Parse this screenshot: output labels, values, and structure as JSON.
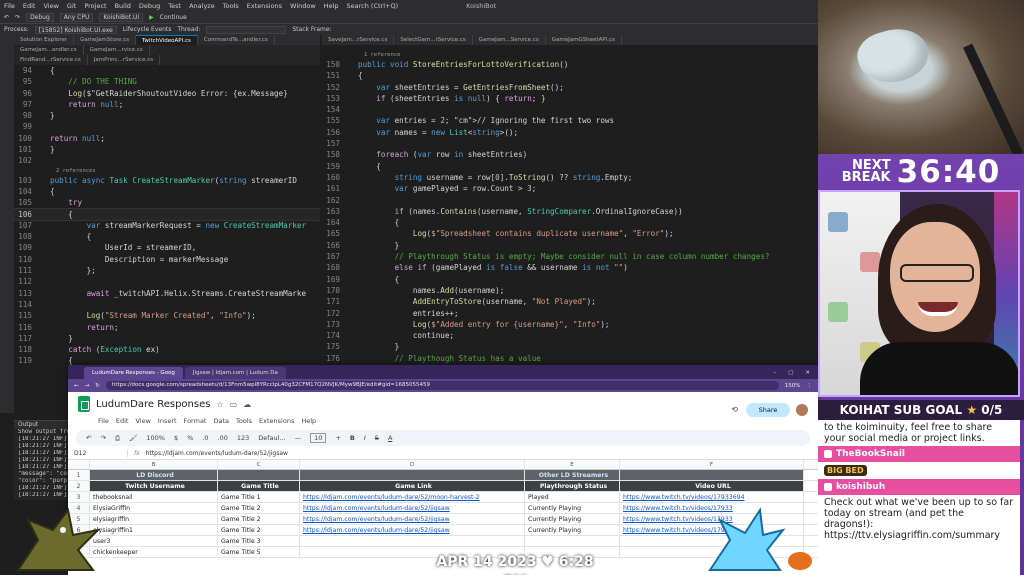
{
  "ide": {
    "menu": [
      "File",
      "Edit",
      "View",
      "Git",
      "Project",
      "Build",
      "Debug",
      "Test",
      "Analyze",
      "Tools",
      "Extensions",
      "Window",
      "Help",
      "Search (Ctrl+Q)"
    ],
    "solution_name": "KoishiBot",
    "toolbar": {
      "config": "Debug",
      "platform": "Any CPU",
      "project": "KoishiBot.UI",
      "continue": "Continue"
    },
    "procbar": {
      "process_label": "Process:",
      "process": "[15852] KoishiBot.UI.exe",
      "lifecycle": "Lifecycle Events",
      "thread_label": "Thread:",
      "stackframe": "Stack Frame:"
    },
    "left_tabs": [
      "Solution Explorer",
      "GameJamStore.cs",
      "TwitchVideoAPI.cs",
      "CommandTe...andler.cs"
    ],
    "left_tabs2": [
      "GameJam...andler.cs",
      "GameJam...rvice.cs"
    ],
    "left_tabs3": [
      "FindRand...rService.cs",
      "JamPrinc...rService.cs"
    ],
    "right_tabs": [
      "SaveJam...rService.cs",
      "SelectGam...rService.cs",
      "GameJam...Service.cs",
      "GameJamGSheetAPI.cs"
    ],
    "left_code": [
      {
        "n": "94",
        "t": "{"
      },
      {
        "n": "95",
        "t": "    // DO THE THING"
      },
      {
        "n": "96",
        "t": "    Log($\"GetRaiderShoutoutVideo Error: {ex.Message}"
      },
      {
        "n": "97",
        "t": "    return null;"
      },
      {
        "n": "98",
        "t": "}"
      },
      {
        "n": "99",
        "t": ""
      },
      {
        "n": "100",
        "t": "return null;"
      },
      {
        "n": "101",
        "t": "}"
      },
      {
        "n": "102",
        "t": ""
      },
      {
        "meta": "2 references"
      },
      {
        "n": "103",
        "t": "public async Task CreateStreamMarker(string streamerID"
      },
      {
        "n": "104",
        "t": "{"
      },
      {
        "n": "105",
        "t": "    try"
      },
      {
        "n": "106",
        "t": "    {"
      },
      {
        "n": "107",
        "t": "        var streamMarkerRequest = new CreateStreamMarker"
      },
      {
        "n": "108",
        "t": "        {"
      },
      {
        "n": "109",
        "t": "            UserId = streamerID,"
      },
      {
        "n": "110",
        "t": "            Description = markerMessage"
      },
      {
        "n": "111",
        "t": "        };"
      },
      {
        "n": "112",
        "t": ""
      },
      {
        "n": "113",
        "t": "        await _twitchAPI.Helix.Streams.CreateStreamMarke"
      },
      {
        "n": "114",
        "t": ""
      },
      {
        "n": "115",
        "t": "        Log(\"Stream Marker Created\", \"Info\");"
      },
      {
        "n": "116",
        "t": "        return;"
      },
      {
        "n": "117",
        "t": "    }"
      },
      {
        "n": "118",
        "t": "    catch (Exception ex)"
      },
      {
        "n": "119",
        "t": "    {"
      }
    ],
    "right_code": [
      {
        "meta": "1 reference"
      },
      {
        "n": "150",
        "t": "public void StoreEntriesForLottoVerification()"
      },
      {
        "n": "151",
        "t": "{"
      },
      {
        "n": "152",
        "t": "    var sheetEntries = GetEntriesFromSheet();"
      },
      {
        "n": "153",
        "t": "    if (sheetEntries is null) { return; }"
      },
      {
        "n": "154",
        "t": ""
      },
      {
        "n": "155",
        "t": "    var entries = 2; // Ignoring the first two rows"
      },
      {
        "n": "156",
        "t": "    var names = new List<string>();"
      },
      {
        "n": "157",
        "t": ""
      },
      {
        "n": "158",
        "t": "    foreach (var row in sheetEntries)"
      },
      {
        "n": "159",
        "t": "    {"
      },
      {
        "n": "160",
        "t": "        string username = row[0].ToString() ?? string.Empty;"
      },
      {
        "n": "161",
        "t": "        var gamePlayed = row.Count > 3;"
      },
      {
        "n": "162",
        "t": ""
      },
      {
        "n": "163",
        "t": "        if (names.Contains(username, StringComparer.OrdinalIgnoreCase))"
      },
      {
        "n": "164",
        "t": "        {"
      },
      {
        "n": "165",
        "t": "            Log($\"Spreadsheet contains duplicate username\", \"Error\");"
      },
      {
        "n": "166",
        "t": "        }"
      },
      {
        "n": "167",
        "t": "        // Playthrough Status is empty; Maybe consider null in case column number changes?"
      },
      {
        "n": "168",
        "t": "        else if (gamePlayed is false && username is not \"\")"
      },
      {
        "n": "169",
        "t": "        {"
      },
      {
        "n": "170",
        "t": "            names.Add(username);"
      },
      {
        "n": "171",
        "t": "            AddEntryToStore(username, \"Not Played\");"
      },
      {
        "n": "172",
        "t": "            entries++;"
      },
      {
        "n": "173",
        "t": "            Log($\"Added entry for {username}\", \"Info\");"
      },
      {
        "n": "174",
        "t": "            continue;"
      },
      {
        "n": "175",
        "t": "        }"
      },
      {
        "n": "176",
        "t": "        // Playthough Status has a value"
      },
      {
        "n": "177",
        "t": "        else if (gamePlayed is true)"
      }
    ],
    "output": {
      "title": "Output",
      "show_from": "Show output from:",
      "lines": [
        "[18:21:27 INF]",
        "[18:21:27 INF]",
        "[18:21:27 INF]",
        "[18:21:27 INF]",
        "[18:21:27 INF]",
        "\"message\": \"col",
        "\"color\": \"purpl",
        "[18:21:27 INF]",
        "[18:21:27 INF]"
      ]
    }
  },
  "browser": {
    "tabs": [
      "LudumDare Responses - Goog",
      "Jigsaw | ldjam.com | Ludum Da"
    ],
    "window_controls": [
      "–",
      "▢",
      "✕"
    ],
    "url": "https://docs.google.com/spreadsheets/d/13Fnm5wpl8YRcclpL40g32CFM17Q2NVJK/Myw9BJE/edit#gid=1685055459",
    "zoom_badge": "150%",
    "sheet_title": "LudumDare Responses",
    "menu": [
      "File",
      "Edit",
      "View",
      "Insert",
      "Format",
      "Data",
      "Tools",
      "Extensions",
      "Help"
    ],
    "share": "Share",
    "toolbar": {
      "zoom": "100%",
      "currency": "$",
      "percent": "%",
      "decimals": ".0",
      "decimals2": ".00",
      "numfmt": "123",
      "font": "Defaul...",
      "minus": "—",
      "size": "10",
      "plus": "+",
      "bold": "B",
      "italic": "I",
      "strike": "S",
      "textcolor": "A"
    },
    "formula": {
      "cell": "D12",
      "fx": "fx",
      "value": "https://ldjam.com/events/ludum-dare/52/jigsaw"
    },
    "columns": [
      "B",
      "C",
      "D",
      "E",
      "F"
    ],
    "header1": [
      "LD Discord",
      "",
      "",
      "Other LD Streamers",
      ""
    ],
    "header2": [
      "Twitch Username",
      "Game Title",
      "Game Link",
      "Playthrough Status",
      "Video URL"
    ],
    "rows": [
      {
        "r": "3",
        "b": "thebooksnail",
        "c": "Game Title 1",
        "d": "https://ldjam.com/events/ludum-dare/52/moon-harvest-2",
        "e": "Played",
        "f": "https://www.twitch.tv/videos/17933694"
      },
      {
        "r": "4",
        "b": "ElysiaGriffin",
        "c": "Game Title 2",
        "d": "https://ldjam.com/events/ludum-dare/52/jigsaw",
        "e": "Currently Playing",
        "f": "https://www.twitch.tv/videos/17933"
      },
      {
        "r": "5",
        "b": "elysiagriffin",
        "c": "Game Title 2",
        "d": "https://ldjam.com/events/ludum-dare/52/jigsaw",
        "e": "Currently Playing",
        "f": "https://www.twitch.tv/videos/17933"
      },
      {
        "r": "6",
        "b": "elysiagriffin1",
        "c": "Game Title 2",
        "d": "https://ldjam.com/events/ludum-dare/52/jigsaw",
        "e": "Currently Playing",
        "f": "https://www.twitch.tv/videos/17933"
      },
      {
        "r": "7",
        "b": "user3",
        "c": "Game Title 3",
        "d": "",
        "e": "",
        "f": ""
      },
      {
        "r": "8",
        "b": "chickenkeeper",
        "c": "Game Title 5",
        "d": "",
        "e": "",
        "f": ""
      }
    ]
  },
  "overlay": {
    "next_break_line1": "NEXT",
    "next_break_line2": "BREAK",
    "timer": "36:40",
    "sub_goal_label": "KOIHAT SUB GOAL",
    "sub_goal_value": "0/5",
    "chat": {
      "msg1": "to the koiminuity, feel free to share your social media or project links.",
      "user2": "TheBookSnail",
      "emote2": "BIG BED",
      "user3": "koishibuh",
      "msg3": "Check out what we've been up to so far today on stream (and pet the dragons!): https://ttv.elysiagriffin.com/summary"
    },
    "date": "APR 14 2023",
    "time": "6:28 PM"
  },
  "colors": {
    "accent": "#7a47b8",
    "vs_blue": "#007acc",
    "sheets_green": "#0f9d58",
    "chat_badge": "#e84ea0"
  }
}
